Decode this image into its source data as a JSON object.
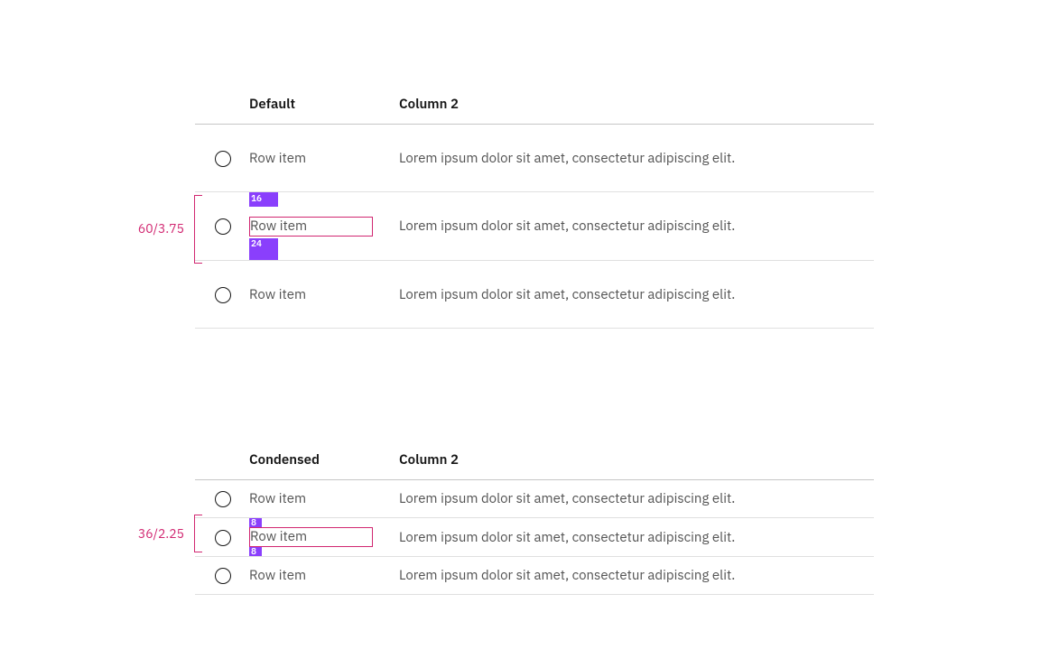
{
  "tables": {
    "default": {
      "headers": {
        "c1": "Default",
        "c2": "Column 2"
      },
      "rows": [
        {
          "c1": "Row item",
          "c2": "Lorem ipsum dolor sit amet, consectetur adipiscing elit."
        },
        {
          "c1": "Row item",
          "c2": "Lorem ipsum dolor sit amet, consectetur adipiscing elit."
        },
        {
          "c1": "Row item",
          "c2": "Lorem ipsum dolor sit amet, consectetur adipiscing elit."
        }
      ],
      "spec": {
        "height_label": "60/3.75",
        "pad_top": "16",
        "pad_bottom": "24"
      }
    },
    "condensed": {
      "headers": {
        "c1": "Condensed",
        "c2": "Column 2"
      },
      "rows": [
        {
          "c1": "Row item",
          "c2": "Lorem ipsum dolor sit amet, consectetur adipiscing elit."
        },
        {
          "c1": "Row item",
          "c2": "Lorem ipsum dolor sit amet, consectetur adipiscing elit."
        },
        {
          "c1": "Row item",
          "c2": "Lorem ipsum dolor sit amet, consectetur adipiscing elit."
        }
      ],
      "spec": {
        "height_label": "36/2.25",
        "pad_top": "8",
        "pad_bottom": "8"
      }
    }
  }
}
